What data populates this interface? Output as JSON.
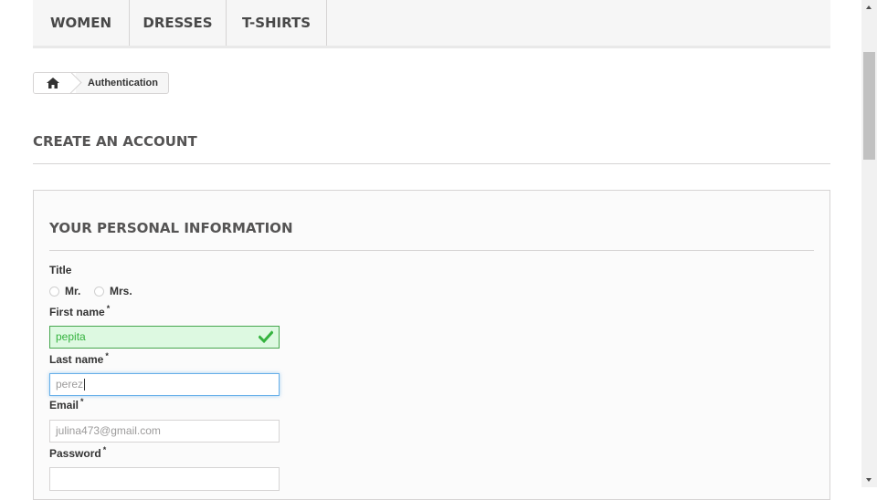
{
  "nav": {
    "women": "WOMEN",
    "dresses": "DRESSES",
    "tshirts": "T-SHIRTS"
  },
  "breadcrumb": {
    "home_icon": "home-icon",
    "current": "Authentication"
  },
  "page": {
    "heading": "CREATE AN ACCOUNT"
  },
  "form": {
    "section_title": "YOUR PERSONAL INFORMATION",
    "title_label": "Title",
    "title_options": [
      "Mr.",
      "Mrs."
    ],
    "first_name": {
      "label": "First name",
      "required": "*",
      "value": "pepita",
      "state": "valid"
    },
    "last_name": {
      "label": "Last name",
      "required": "*",
      "value": "perez",
      "state": "focused"
    },
    "email": {
      "label": "Email",
      "required": "*",
      "value": "julina473@gmail.com"
    },
    "password": {
      "label": "Password",
      "required": "*",
      "value": ""
    }
  },
  "colors": {
    "valid_bg": "#ddf9e1",
    "valid_border": "#46a74e",
    "valid_check": "#35b33f",
    "focus_border": "#66afe9"
  }
}
